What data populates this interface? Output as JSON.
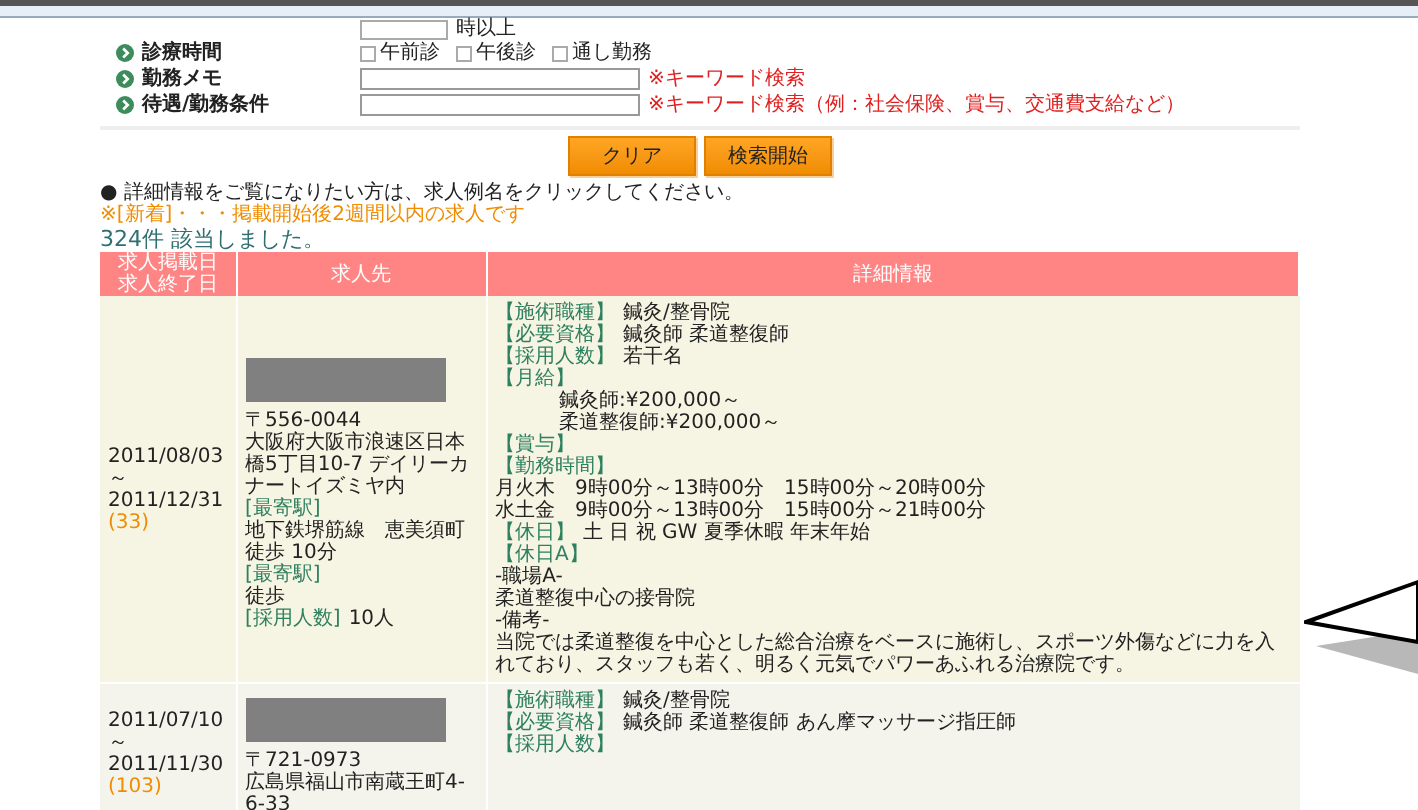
{
  "form": {
    "hours_suffix": "時以上",
    "rows": [
      {
        "kind": "checkboxes",
        "label": "診療時間",
        "options": [
          {
            "label": "午前診",
            "checked": false
          },
          {
            "label": "午後診",
            "checked": false
          },
          {
            "label": "通し勤務",
            "checked": false
          }
        ]
      },
      {
        "kind": "input",
        "label": "勤務メモ",
        "hint": "※キーワード検索"
      },
      {
        "kind": "input",
        "label": "待遇/勤務条件",
        "hint": "※キーワード検索（例：社会保険、賞与、交通費支給など）"
      }
    ],
    "buttons": [
      "クリア",
      "検索開始"
    ]
  },
  "note": "● 詳細情報をご覧になりたい方は、求人例名をクリックしてください。",
  "note_new": "※[新着]・・・掲載開始後2週間以内の求人です",
  "result_count": "324件 該当しました。",
  "table": {
    "columns": [
      [
        "求人掲載日",
        "求人終了日"
      ],
      [
        "求人先"
      ],
      [
        "詳細情報"
      ]
    ],
    "rows": [
      {
        "dates": [
          "2011/08/03",
          "～",
          "2011/12/31"
        ],
        "days": "(33)",
        "employer": [
          {
            "kind": "redacted"
          },
          {
            "kind": "text",
            "text": "〒556-0044"
          },
          {
            "kind": "text",
            "text": "大阪府大阪市浪速区日本橋5丁目10-7 デイリーカナートイズミヤ内"
          },
          {
            "kind": "label",
            "label": "[最寄駅]"
          },
          {
            "kind": "text",
            "text": "地下鉄堺筋線　恵美須町"
          },
          {
            "kind": "text",
            "text": "徒歩 10分"
          },
          {
            "kind": "label",
            "label": "[最寄駅]"
          },
          {
            "kind": "text",
            "text": "徒歩"
          },
          {
            "kind": "labeled",
            "label": "[採用人数]",
            "text": "10人"
          }
        ],
        "details": [
          {
            "kind": "labeled",
            "label": "【施術職種】",
            "text": "鍼灸/整骨院"
          },
          {
            "kind": "labeled",
            "label": "【必要資格】",
            "text": "鍼灸師 柔道整復師"
          },
          {
            "kind": "labeled",
            "label": "【採用人数】",
            "text": "若干名"
          },
          {
            "kind": "label",
            "label": "【月給】"
          },
          {
            "kind": "amount",
            "text": "鍼灸師:¥200,000～"
          },
          {
            "kind": "amount",
            "text": "柔道整復師:¥200,000～"
          },
          {
            "kind": "label",
            "label": "【賞与】"
          },
          {
            "kind": "label",
            "label": "【勤務時間】"
          },
          {
            "kind": "text",
            "text": "月火木　9時00分～13時00分　15時00分～20時00分"
          },
          {
            "kind": "text",
            "text": "水土金　9時00分～13時00分　15時00分～21時00分"
          },
          {
            "kind": "labeled",
            "label": "【休日】",
            "text": "土 日 祝 GW 夏季休暇 年末年始"
          },
          {
            "kind": "label",
            "label": "【休日A】"
          },
          {
            "kind": "text",
            "text": "-職場A-"
          },
          {
            "kind": "text",
            "text": "柔道整復中心の接骨院"
          },
          {
            "kind": "text",
            "text": "-備考-"
          },
          {
            "kind": "text",
            "text": "当院では柔道整復を中心とした総合治療をベースに施術し、スポーツ外傷などに力を入れており、スタッフも若く、明るく元気でパワーあふれる治療院です。"
          }
        ]
      },
      {
        "dates": [
          "2011/07/10",
          "～",
          "2011/11/30"
        ],
        "days": "(103)",
        "employer": [
          {
            "kind": "redacted"
          },
          {
            "kind": "text",
            "text": "〒721-0973"
          },
          {
            "kind": "text",
            "text": "広島県福山市南蔵王町4-6-33"
          }
        ],
        "details": [
          {
            "kind": "labeled",
            "label": "【施術職種】",
            "text": "鍼灸/整骨院"
          },
          {
            "kind": "labeled",
            "label": "【必要資格】",
            "text": "鍼灸師 柔道整復師 あん摩マッサージ指圧師"
          },
          {
            "kind": "label",
            "label": "【採用人数】"
          }
        ]
      }
    ]
  }
}
